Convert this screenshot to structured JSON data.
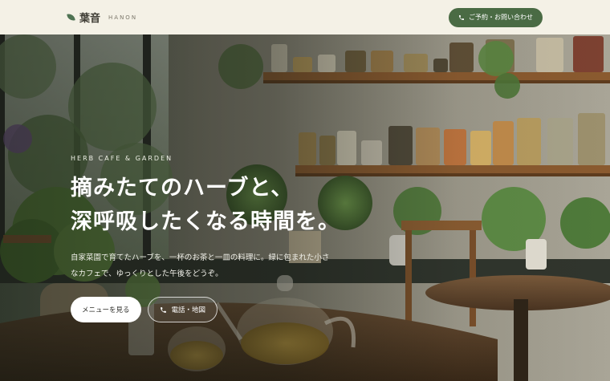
{
  "header": {
    "brand_name": "葉音",
    "brand_sub": "HANON",
    "cta_label": "ご予約・お問い合わせ"
  },
  "hero": {
    "eyebrow": "HERB CAFE & GARDEN",
    "headline_line1": "摘みたてのハーブと、",
    "headline_line2": "深呼吸したくなる時間を。",
    "lead": "自家菜園で育てたハーブを、一杯のお茶と一皿の料理に。緑に包まれた小さなカフェで、ゆっくりとした午後をどうぞ。",
    "primary_button": "メニューを見る",
    "secondary_button": "電話・地図"
  },
  "icons": {
    "brand": "leaf-icon",
    "cta": "phone-icon",
    "secondary": "phone-icon"
  },
  "colors": {
    "header_bg": "#f4f1e6",
    "accent_green": "#4a6b44",
    "text_dark": "#3d3b33"
  }
}
